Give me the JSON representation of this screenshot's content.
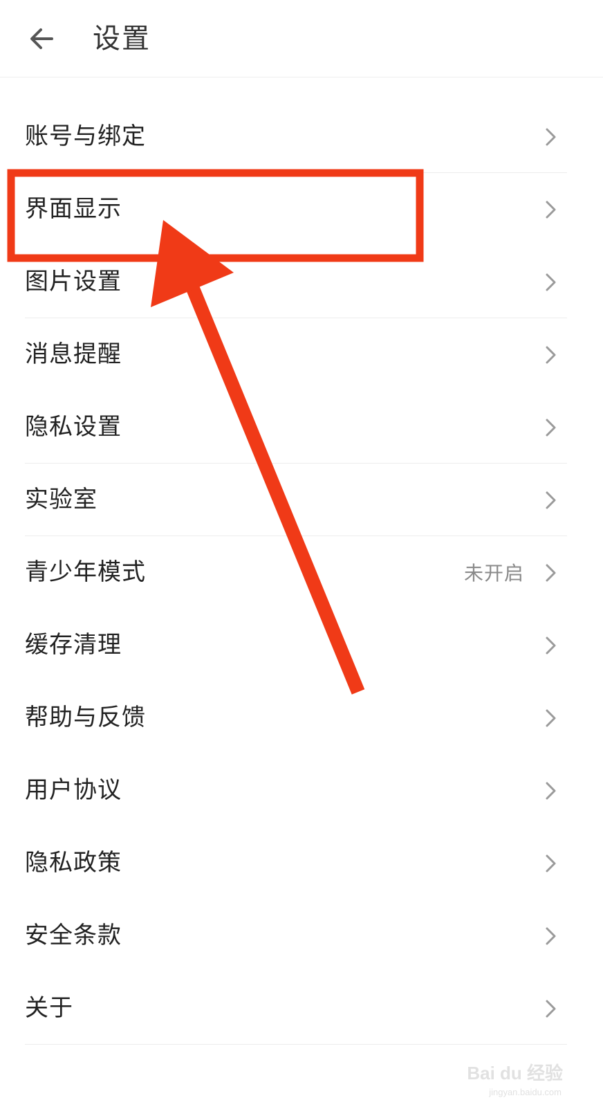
{
  "header": {
    "title": "设置",
    "back_icon": "arrow-left-icon"
  },
  "settings_items": [
    {
      "label": "账号与绑定",
      "value": ""
    },
    {
      "label": "界面显示",
      "value": ""
    },
    {
      "label": "图片设置",
      "value": ""
    },
    {
      "label": "消息提醒",
      "value": ""
    },
    {
      "label": "隐私设置",
      "value": ""
    },
    {
      "label": "实验室",
      "value": ""
    },
    {
      "label": "青少年模式",
      "value": "未开启"
    },
    {
      "label": "缓存清理",
      "value": ""
    },
    {
      "label": "帮助与反馈",
      "value": ""
    },
    {
      "label": "用户协议",
      "value": ""
    },
    {
      "label": "隐私政策",
      "value": ""
    },
    {
      "label": "安全条款",
      "value": ""
    },
    {
      "label": "关于",
      "value": ""
    }
  ],
  "chevron_icon": "chevron-right-icon",
  "annotation": {
    "highlight_color": "#f03a17",
    "arrow_color": "#f03a17"
  },
  "watermark": {
    "text": "Bai du 经验",
    "sub": "jingyan.baidu.com"
  }
}
